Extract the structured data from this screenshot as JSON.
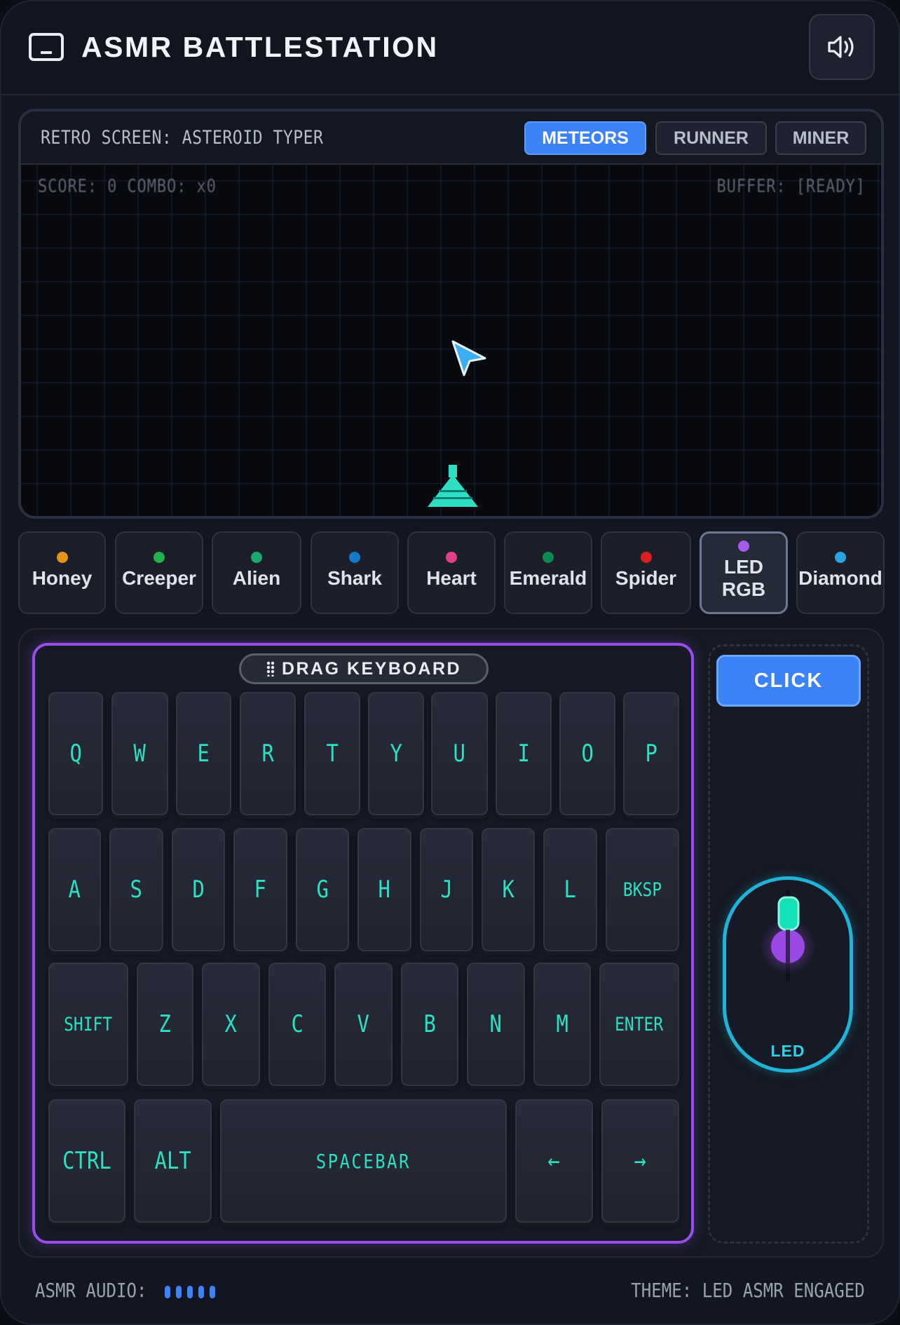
{
  "app": {
    "title": "ASMR BATTLESTATION"
  },
  "screen": {
    "title": "RETRO SCREEN: ASTEROID TYPER",
    "modes": [
      {
        "label": "METEORS",
        "active": true
      },
      {
        "label": "RUNNER",
        "active": false
      },
      {
        "label": "MINER",
        "active": false
      }
    ],
    "hud": {
      "left": "SCORE: 0  COMBO: x0",
      "right": "BUFFER: [READY]"
    }
  },
  "skins": [
    {
      "label": "Honey",
      "color": "#e8921c"
    },
    {
      "label": "Creeper",
      "color": "#22b14c"
    },
    {
      "label": "Alien",
      "color": "#19a872"
    },
    {
      "label": "Shark",
      "color": "#1479c9"
    },
    {
      "label": "Heart",
      "color": "#e0408a"
    },
    {
      "label": "Emerald",
      "color": "#0f8a55"
    },
    {
      "label": "Spider",
      "color": "#d8211f"
    },
    {
      "label": "LED\nRGB",
      "color": "#a55ce8",
      "active": true
    },
    {
      "label": "Diamond",
      "color": "#2aa4e0"
    }
  ],
  "keyboard": {
    "drag_label": "DRAG KEYBOARD",
    "rows": [
      [
        "Q",
        "W",
        "E",
        "R",
        "T",
        "Y",
        "U",
        "I",
        "O",
        "P"
      ],
      [
        "A",
        "S",
        "D",
        "F",
        "G",
        "H",
        "J",
        "K",
        "L",
        "BKSP"
      ],
      [
        "SHIFT",
        "Z",
        "X",
        "C",
        "V",
        "B",
        "N",
        "M",
        "ENTER"
      ],
      [
        "CTRL",
        "ALT",
        "SPACEBAR",
        "←",
        "→"
      ]
    ]
  },
  "mouse": {
    "click_label": "CLICK",
    "label": "LED"
  },
  "footer": {
    "audio_label": "ASMR AUDIO:",
    "theme_label": "THEME: LED ASMR ENGAGED"
  },
  "colors": {
    "accent": "#3b82f6",
    "key_legend": "#2de0c4",
    "keyboard_glow": "#9b4de8",
    "mouse_glow": "#20b4d6"
  }
}
